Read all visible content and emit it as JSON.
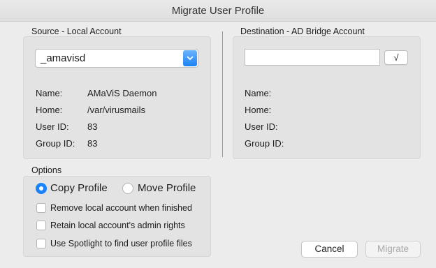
{
  "window": {
    "title": "Migrate User Profile"
  },
  "source": {
    "heading": "Source - Local Account",
    "account_value": "_amavisd",
    "rows": [
      {
        "label": "Name:",
        "value": "AMaViS Daemon"
      },
      {
        "label": "Home:",
        "value": "/var/virusmails"
      },
      {
        "label": "User ID:",
        "value": "83"
      },
      {
        "label": "Group ID:",
        "value": "83"
      }
    ]
  },
  "destination": {
    "heading": "Destination - AD Bridge Account",
    "account_value": "",
    "check_button_label": "√",
    "rows": [
      {
        "label": "Name:",
        "value": ""
      },
      {
        "label": "Home:",
        "value": ""
      },
      {
        "label": "User ID:",
        "value": ""
      },
      {
        "label": "Group ID:",
        "value": ""
      }
    ]
  },
  "options": {
    "heading": "Options",
    "radios": [
      {
        "label": "Copy Profile",
        "selected": true
      },
      {
        "label": "Move Profile",
        "selected": false
      }
    ],
    "checkboxes": [
      {
        "label": "Remove local account when finished",
        "checked": false
      },
      {
        "label": "Retain local account's admin rights",
        "checked": false
      },
      {
        "label": "Use Spotlight to find user profile files",
        "checked": false
      }
    ]
  },
  "buttons": {
    "cancel": "Cancel",
    "migrate": "Migrate"
  },
  "colors": {
    "accent": "#1a82fb",
    "panel": "#e3e3e3",
    "window": "#ececec"
  }
}
